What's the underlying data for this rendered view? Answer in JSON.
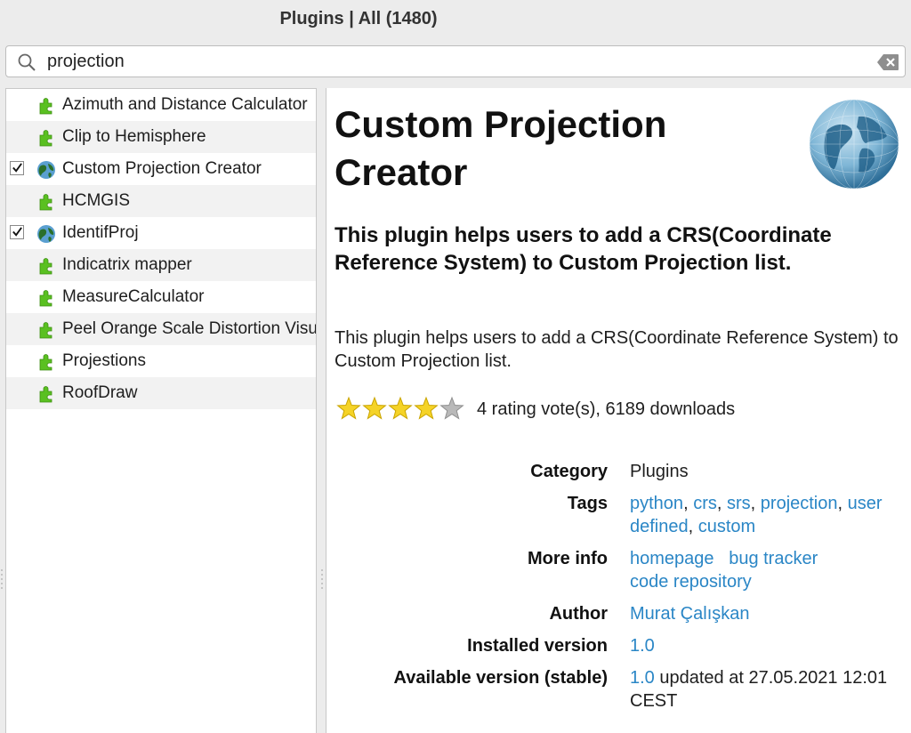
{
  "window": {
    "title": "Plugins | All (1480)"
  },
  "search": {
    "value": "projection",
    "placeholder": ""
  },
  "plugins": [
    {
      "name": "Azimuth and Distance Calculator",
      "checked": false,
      "icon": "plugin-icon"
    },
    {
      "name": "Clip to Hemisphere",
      "checked": false,
      "icon": "plugin-icon"
    },
    {
      "name": "Custom Projection Creator",
      "checked": true,
      "icon": "globe-icon"
    },
    {
      "name": "HCMGIS",
      "checked": false,
      "icon": "plugin-icon"
    },
    {
      "name": "IdentifProj",
      "checked": true,
      "icon": "globe-icon"
    },
    {
      "name": "Indicatrix mapper",
      "checked": false,
      "icon": "plugin-icon"
    },
    {
      "name": "MeasureCalculator",
      "checked": false,
      "icon": "plugin-icon"
    },
    {
      "name": "Peel Orange Scale Distortion Visualizer",
      "checked": false,
      "icon": "plugin-icon"
    },
    {
      "name": "Projestions",
      "checked": false,
      "icon": "plugin-icon"
    },
    {
      "name": "RoofDraw",
      "checked": false,
      "icon": "plugin-icon"
    }
  ],
  "detail": {
    "title": "Custom Projection Creator",
    "subtitle": "This plugin helps users to add a CRS(Coordinate Reference System) to Custom Projection list.",
    "description": "This plugin helps users to add a CRS(Coordinate Reference System) to Custom Projection list.",
    "rating_stars": 4,
    "rating_max": 5,
    "rating_text": "4 rating vote(s), 6189 downloads",
    "category_label": "Category",
    "category": "Plugins",
    "tags_label": "Tags",
    "tags": [
      "python",
      "crs",
      "srs",
      "projection",
      "user defined",
      "custom"
    ],
    "moreinfo_label": "More info",
    "links": {
      "homepage": "homepage",
      "bugtracker": "bug tracker",
      "repository": "code repository"
    },
    "author_label": "Author",
    "author": "Murat Çalışkan",
    "installed_label": "Installed version",
    "installed_version": "1.0",
    "available_label": "Available version (stable)",
    "available_version": "1.0",
    "available_rest": " updated at 27.05.2021 12:01 CEST"
  },
  "colors": {
    "link": "#2a86c6",
    "plugin_green": "#5ac021",
    "row_alt": "#f2f2f2",
    "star": "#f5d327"
  }
}
